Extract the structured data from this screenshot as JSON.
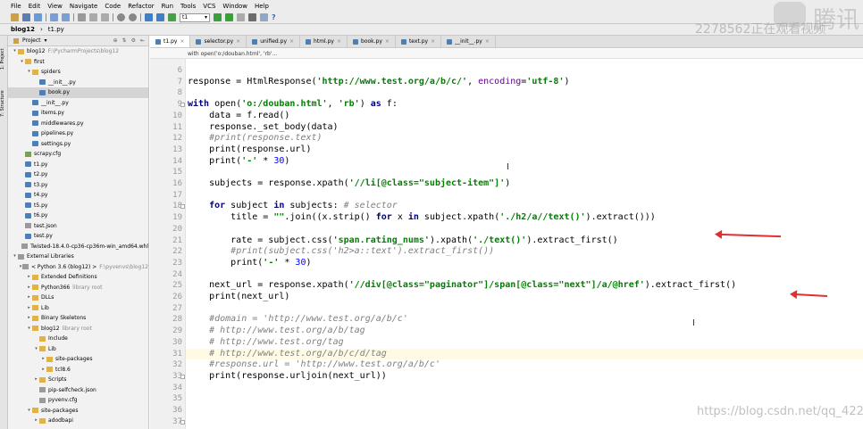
{
  "menu": [
    "File",
    "Edit",
    "View",
    "Navigate",
    "Code",
    "Refactor",
    "Run",
    "Tools",
    "VCS",
    "Window",
    "Help"
  ],
  "run_config": "t1",
  "breadcrumb": [
    "blog12",
    "t1.py"
  ],
  "project_panel": {
    "label": "Project"
  },
  "tree": [
    {
      "text": "blog12",
      "extra": "F:\\PycharmProjects\\blog12",
      "icon": "fold",
      "level": 0,
      "arrow": "▾"
    },
    {
      "text": "first",
      "icon": "fold",
      "level": 1,
      "arrow": "▾"
    },
    {
      "text": "spiders",
      "icon": "fold",
      "level": 2,
      "arrow": "▾"
    },
    {
      "text": "__init__.py",
      "icon": "pyf",
      "level": 3,
      "arrow": ""
    },
    {
      "text": "book.py",
      "icon": "pyf",
      "level": 3,
      "arrow": "",
      "selected": true
    },
    {
      "text": "__init__.py",
      "icon": "pyf",
      "level": 2,
      "arrow": ""
    },
    {
      "text": "items.py",
      "icon": "pyf",
      "level": 2,
      "arrow": ""
    },
    {
      "text": "middlewares.py",
      "icon": "pyf",
      "level": 2,
      "arrow": ""
    },
    {
      "text": "pipelines.py",
      "icon": "pyf",
      "level": 2,
      "arrow": ""
    },
    {
      "text": "settings.py",
      "icon": "pyf",
      "level": 2,
      "arrow": ""
    },
    {
      "text": "scrapy.cfg",
      "icon": "cfg",
      "level": 1,
      "arrow": ""
    },
    {
      "text": "t1.py",
      "icon": "pyf",
      "level": 1,
      "arrow": ""
    },
    {
      "text": "t2.py",
      "icon": "pyf",
      "level": 1,
      "arrow": ""
    },
    {
      "text": "t3.py",
      "icon": "pyf",
      "level": 1,
      "arrow": ""
    },
    {
      "text": "t4.py",
      "icon": "pyf",
      "level": 1,
      "arrow": ""
    },
    {
      "text": "t5.py",
      "icon": "pyf",
      "level": 1,
      "arrow": ""
    },
    {
      "text": "t6.py",
      "icon": "pyf",
      "level": 1,
      "arrow": ""
    },
    {
      "text": "test.json",
      "icon": "gen",
      "level": 1,
      "arrow": ""
    },
    {
      "text": "test.py",
      "icon": "pyf",
      "level": 1,
      "arrow": ""
    },
    {
      "text": "Twisted-18.4.0-cp36-cp36m-win_amd64.whl",
      "icon": "gen",
      "level": 1,
      "arrow": ""
    },
    {
      "text": "External Libraries",
      "icon": "gen",
      "level": 0,
      "arrow": "▾"
    },
    {
      "text": "< Python 3.6 (blog12) >",
      "extra": "F:\\pyvenvs\\blog12",
      "icon": "gen",
      "level": 1,
      "arrow": "▾"
    },
    {
      "text": "Extended Definitions",
      "icon": "fold",
      "level": 2,
      "arrow": "▸"
    },
    {
      "text": "Python366",
      "extra": "library root",
      "icon": "fold",
      "level": 2,
      "arrow": "▸"
    },
    {
      "text": "DLLs",
      "icon": "fold",
      "level": 2,
      "arrow": "▸"
    },
    {
      "text": "Lib",
      "icon": "fold",
      "level": 2,
      "arrow": "▸"
    },
    {
      "text": "Binary Skeletons",
      "icon": "fold",
      "level": 2,
      "arrow": "▸"
    },
    {
      "text": "blog12",
      "extra": "library root",
      "icon": "fold",
      "level": 2,
      "arrow": "▾"
    },
    {
      "text": "Include",
      "icon": "fold",
      "level": 3,
      "arrow": ""
    },
    {
      "text": "Lib",
      "icon": "fold",
      "level": 3,
      "arrow": "▾"
    },
    {
      "text": "site-packages",
      "icon": "fold",
      "level": 4,
      "arrow": "▸"
    },
    {
      "text": "tcl8.6",
      "icon": "fold",
      "level": 4,
      "arrow": "▸"
    },
    {
      "text": "Scripts",
      "icon": "fold",
      "level": 3,
      "arrow": "▸"
    },
    {
      "text": "pip-selfcheck.json",
      "icon": "gen",
      "level": 3,
      "arrow": ""
    },
    {
      "text": "pyvenv.cfg",
      "icon": "gen",
      "level": 3,
      "arrow": ""
    },
    {
      "text": "site-packages",
      "icon": "fold",
      "level": 2,
      "arrow": "▾"
    },
    {
      "text": "adodbapi",
      "icon": "fold",
      "level": 3,
      "arrow": "▸"
    }
  ],
  "tabs": [
    {
      "label": "t1.py",
      "active": true
    },
    {
      "label": "selector.py"
    },
    {
      "label": "unified.py"
    },
    {
      "label": "html.py"
    },
    {
      "label": "book.py"
    },
    {
      "label": "text.py"
    },
    {
      "label": "__init__.py"
    }
  ],
  "context_crumb": "with open('o:/douban.html', 'rb'...",
  "code_lines": [
    {
      "n": "6",
      "html": ""
    },
    {
      "n": "7",
      "html": "response = HtmlResponse(<span class='str'>'http://www.test.org/a/b/c/'</span>, <span class='param'>encoding</span>=<span class='str'>'utf-8'</span>)"
    },
    {
      "n": "8",
      "html": ""
    },
    {
      "n": "9",
      "html": "<span class='kw'>with</span> open(<span class='str'>'o:/douban.html'</span>, <span class='str'>'rb'</span>) <span class='kw'>as</span> f:"
    },
    {
      "n": "10",
      "html": "    data = f.read()"
    },
    {
      "n": "11",
      "html": "    response._set_body(data)"
    },
    {
      "n": "12",
      "html": "    <span class='cmt'>#print(response.text)</span>"
    },
    {
      "n": "13",
      "html": "    print(response.url)"
    },
    {
      "n": "14",
      "html": "    print(<span class='str'>'-'</span> * <span class='num'>30</span>)"
    },
    {
      "n": "15",
      "html": ""
    },
    {
      "n": "16",
      "html": "    subjects = response.xpath(<span class='str'>'//li[@class=\"subject-item\"]'</span>)"
    },
    {
      "n": "17",
      "html": ""
    },
    {
      "n": "18",
      "html": "    <span class='kw'>for</span> subject <span class='kw'>in</span> subjects: <span class='cmt'># selector</span>"
    },
    {
      "n": "19",
      "html": "        title = <span class='str'>\"\"</span>.join((x.strip() <span class='kw'>for</span> x <span class='kw'>in</span> subject.xpath(<span class='str'>'./h2/a//text()'</span>).extract()))"
    },
    {
      "n": "20",
      "html": ""
    },
    {
      "n": "21",
      "html": "        rate = subject.css(<span class='str'>'span.rating_nums'</span>).xpath(<span class='str'>'./text()'</span>).extract_first()"
    },
    {
      "n": "22",
      "html": "        <span class='cmt'>#print(subject.css('h2&gt;a::text').extract_first())</span>"
    },
    {
      "n": "23",
      "html": "        print(<span class='str'>'-'</span> * <span class='num'>30</span>)"
    },
    {
      "n": "24",
      "html": ""
    },
    {
      "n": "25",
      "html": "    next_url = response.xpath(<span class='str'>'//div[@class=\"paginator\"]/span[@class=\"next\"]/a/@href'</span>).extract_first()"
    },
    {
      "n": "26",
      "html": "    print(next_url)"
    },
    {
      "n": "27",
      "html": ""
    },
    {
      "n": "28",
      "html": "    <span class='cmt'>#domain = 'http://www.test.org/a/b/c'</span>"
    },
    {
      "n": "29",
      "html": "    <span class='cmt'># http://www.test.org/a/b/tag</span>"
    },
    {
      "n": "30",
      "html": "    <span class='cmt'># http://www.test.org/tag</span>"
    },
    {
      "n": "31",
      "html": "    <span class='cmt'># http://www.test.org/a/b/c/d/tag</span>",
      "hl": true
    },
    {
      "n": "32",
      "html": "    <span class='cmt'>#response.url = 'http://www.test.org/a/b/c'</span>"
    },
    {
      "n": "33",
      "html": "    print(response.urljoin(next_url))"
    },
    {
      "n": "34",
      "html": ""
    },
    {
      "n": "35",
      "html": ""
    },
    {
      "n": "36",
      "html": ""
    },
    {
      "n": "37",
      "html": ""
    }
  ],
  "watermarks": {
    "viewers": "2278562正在观看视频",
    "brand": "腾讯",
    "blog": "https://blog.csdn.net/qq_42227818"
  }
}
